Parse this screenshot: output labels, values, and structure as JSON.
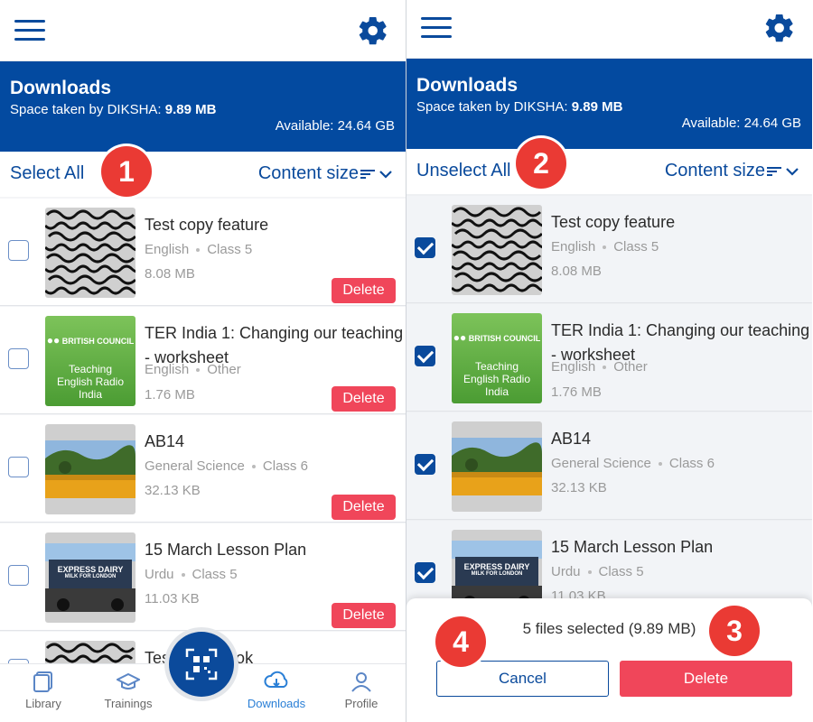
{
  "left": {
    "header": {
      "title": "Downloads",
      "space_label": "Space taken by DIKSHA:",
      "space_value": "9.89 MB",
      "available": "Available: 24.64 GB"
    },
    "toolbar": {
      "select_label": "Select All",
      "sort_label": "Content size"
    },
    "items": [
      {
        "title": "Test copy feature",
        "title2": "",
        "meta1": "English",
        "meta2": "Class 5",
        "size": "8.08 MB",
        "delete": "Delete"
      },
      {
        "title": "TER India 1: Changing our teaching",
        "title2": "- worksheet",
        "meta1": "English",
        "meta2": "Other",
        "size": "1.76 MB",
        "delete": "Delete"
      },
      {
        "title": "AB14",
        "title2": "",
        "meta1": "General Science",
        "meta2": "Class 6",
        "size": "32.13 KB",
        "delete": "Delete"
      },
      {
        "title": "15 March Lesson Plan",
        "title2": "",
        "meta1": "Urdu",
        "meta2": "Class 5",
        "size": "11.03 KB",
        "delete": "Delete"
      },
      {
        "title": "Test copy book",
        "title2": "",
        "meta1": "",
        "meta2": "",
        "size": "",
        "delete": ""
      }
    ],
    "bottom_nav": [
      {
        "label": "Library",
        "icon": "library-icon"
      },
      {
        "label": "Trainings",
        "icon": "graduation-cap-icon"
      },
      {
        "label": "Downloads",
        "icon": "cloud-download-icon",
        "active": true
      },
      {
        "label": "Profile",
        "icon": "user-icon"
      }
    ],
    "step": "1"
  },
  "right": {
    "header": {
      "title": "Downloads",
      "space_label": "Space taken by DIKSHA:",
      "space_value": "9.89 MB",
      "available": "Available: 24.64 GB"
    },
    "toolbar": {
      "select_label": "Unselect All",
      "sort_label": "Content size"
    },
    "items": [
      {
        "title": "Test copy feature",
        "title2": "",
        "meta1": "English",
        "meta2": "Class 5",
        "size": "8.08 MB"
      },
      {
        "title": "TER India 1: Changing our teaching",
        "title2": "- worksheet",
        "meta1": "English",
        "meta2": "Other",
        "size": "1.76 MB"
      },
      {
        "title": "AB14",
        "title2": "",
        "meta1": "General Science",
        "meta2": "Class 6",
        "size": "32.13 KB"
      },
      {
        "title": "15 March Lesson Plan",
        "title2": "",
        "meta1": "Urdu",
        "meta2": "Class 5",
        "size": "11.03 KB"
      }
    ],
    "sheet": {
      "count_text": "5 files selected (9.89 MB)",
      "cancel_label": "Cancel",
      "delete_label": "Delete"
    },
    "steps": [
      "2",
      "3",
      "4"
    ]
  },
  "thumb_british_council": {
    "brand": "BRITISH COUNCIL",
    "line1": "Teaching",
    "line2": "English Radio",
    "line3": "India"
  },
  "thumb_express_dairy": {
    "text1": "EXPRESS DAIRY",
    "text2": "MILK FOR LONDON"
  },
  "colors": {
    "brand_blue": "#034aa0",
    "danger": "#f0465a",
    "step_red": "#ea3a34",
    "nav_active": "#2a7fd6"
  }
}
